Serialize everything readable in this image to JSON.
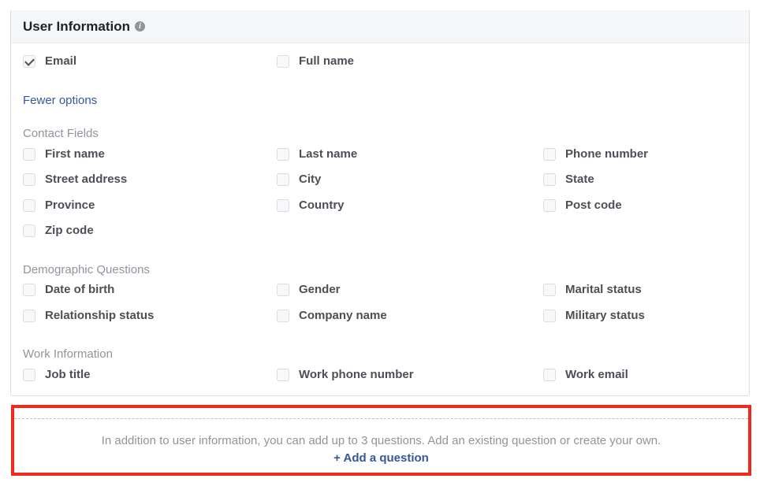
{
  "header": {
    "title": "User Information",
    "info_icon": "info-icon"
  },
  "basic_fields": [
    {
      "label": "Email",
      "checked": true
    },
    {
      "label": "Full name",
      "checked": false
    }
  ],
  "options_link": "Fewer options",
  "sections": {
    "contact": {
      "title": "Contact Fields",
      "fields": [
        "First name",
        "Last name",
        "Phone number",
        "Street address",
        "City",
        "State",
        "Province",
        "Country",
        "Post code",
        "Zip code"
      ]
    },
    "demographic": {
      "title": "Demographic Questions",
      "fields": [
        "Date of birth",
        "Gender",
        "Marital status",
        "Relationship status",
        "Company name",
        "Military status"
      ]
    },
    "work": {
      "title": "Work Information",
      "fields": [
        "Job title",
        "Work phone number",
        "Work email"
      ]
    }
  },
  "questions": {
    "description": "In addition to user information, you can add up to 3 questions. Add an existing question or create your own.",
    "add_label": "+ Add a question"
  },
  "colors": {
    "link": "#365899",
    "highlight_border": "#f02a1e",
    "muted_text": "#90949c",
    "label_text": "#4b4f56"
  }
}
